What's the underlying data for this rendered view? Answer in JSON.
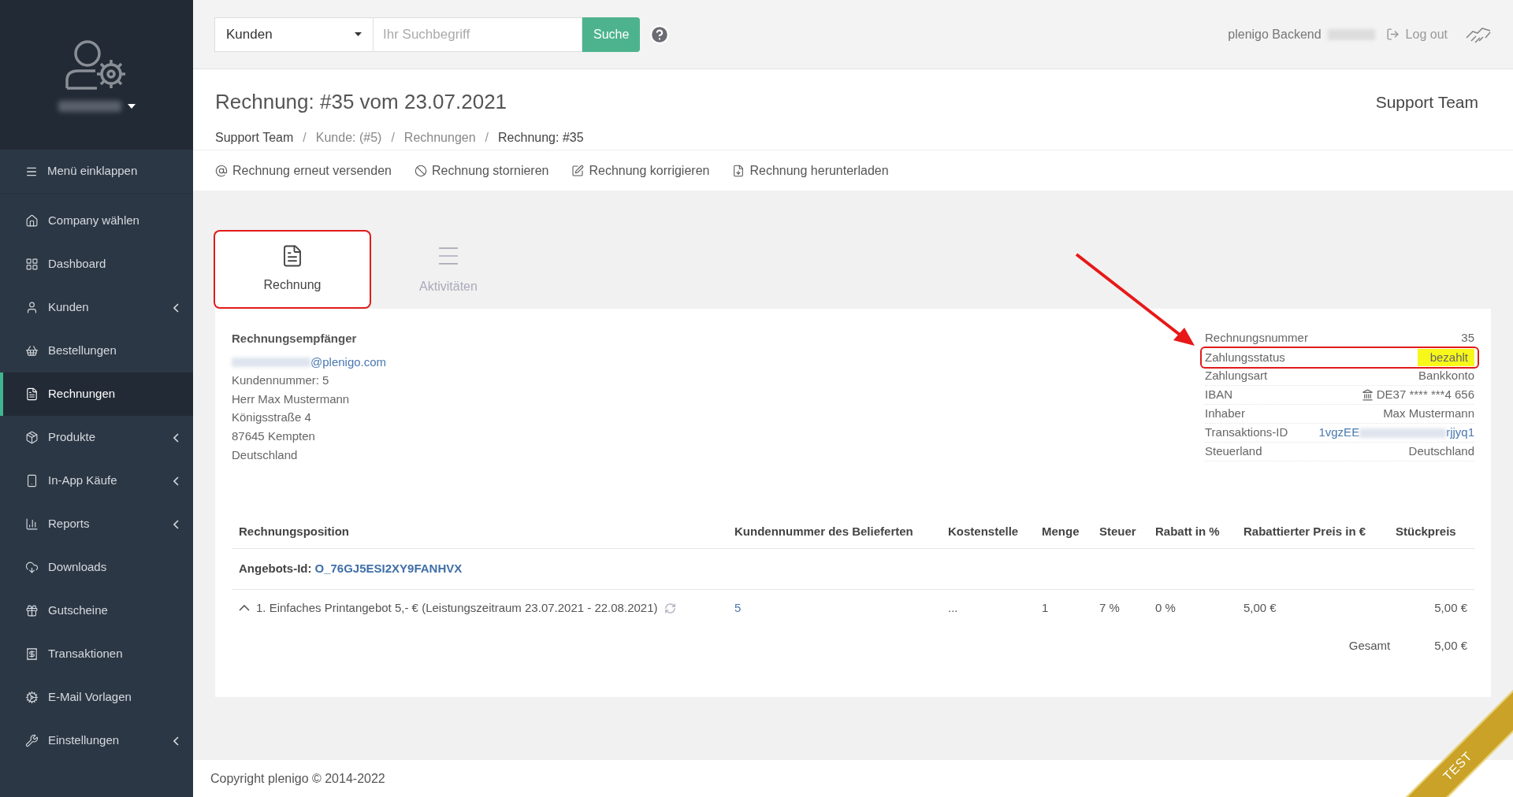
{
  "sidebar": {
    "collapse": "Menü einklappen",
    "items": [
      {
        "label": "Company wählen",
        "selected": false,
        "expandable": false
      },
      {
        "label": "Dashboard",
        "selected": false,
        "expandable": false
      },
      {
        "label": "Kunden",
        "selected": false,
        "expandable": true
      },
      {
        "label": "Bestellungen",
        "selected": false,
        "expandable": false
      },
      {
        "label": "Rechnungen",
        "selected": true,
        "expandable": false
      },
      {
        "label": "Produkte",
        "selected": false,
        "expandable": true
      },
      {
        "label": "In-App Käufe",
        "selected": false,
        "expandable": true
      },
      {
        "label": "Reports",
        "selected": false,
        "expandable": true
      },
      {
        "label": "Downloads",
        "selected": false,
        "expandable": false
      },
      {
        "label": "Gutscheine",
        "selected": false,
        "expandable": false
      },
      {
        "label": "Transaktionen",
        "selected": false,
        "expandable": false
      },
      {
        "label": "E-Mail Vorlagen",
        "selected": false,
        "expandable": false
      },
      {
        "label": "Einstellungen",
        "selected": false,
        "expandable": true
      }
    ]
  },
  "topbar": {
    "search_scope": "Kunden",
    "search": {
      "placeholder": "Ihr Suchbegriff"
    },
    "search_button": "Suche",
    "app_name": "plenigo Backend",
    "logout": "Log out"
  },
  "header": {
    "title": "Rechnung: #35 vom 23.07.2021",
    "breadcrumbs": [
      "Support Team",
      "Kunde: (#5)",
      "Rechnungen",
      "Rechnung: #35"
    ],
    "breadcrumb_separators": [
      "/",
      "/",
      "/"
    ],
    "team": "Support Team"
  },
  "actions": [
    "Rechnung erneut versenden",
    "Rechnung stornieren",
    "Rechnung korrigieren",
    "Rechnung herunterladen"
  ],
  "tabs": [
    {
      "label": "Rechnung",
      "selected": true
    },
    {
      "label": "Aktivitäten",
      "selected": false
    }
  ],
  "recipient": {
    "heading": "Rechnungsempfänger",
    "email": "@plenigo.com",
    "lines": [
      "Kundennummer: 5",
      "Herr Max Mustermann",
      "Königsstraße 4",
      "87645 Kempten",
      "Deutschland"
    ]
  },
  "details": [
    {
      "kind": "text",
      "label": "Rechnungsnummer",
      "value": "35",
      "highlighted": false
    },
    {
      "kind": "text",
      "label": "Zahlungsstatus",
      "value": "bezahlt",
      "highlighted": true
    },
    {
      "kind": "text",
      "label": "Zahlungsart",
      "value": "Bankkonto",
      "highlighted": false
    },
    {
      "kind": "bank",
      "label": "IBAN",
      "value": "DE37 **** ***4 656",
      "highlighted": false
    },
    {
      "kind": "text",
      "label": "Inhaber",
      "value": "Max Mustermann",
      "highlighted": false
    },
    {
      "kind": "redacted",
      "label": "Transaktions-ID",
      "value": "1vgzEE",
      "value_end": "rjjyq1",
      "highlighted": false
    },
    {
      "kind": "text",
      "label": "Steuerland",
      "value": "Deutschland",
      "highlighted": false
    }
  ],
  "table": {
    "columns": [
      "Rechnungsposition",
      "Kundennummer des Belieferten",
      "Kostenstelle",
      "Menge",
      "Steuer",
      "Rabatt in %",
      "Rabattierter Preis in €",
      "Stückpreis"
    ],
    "offer": {
      "label": "Angebots-Id:",
      "id": "O_76GJ5ESI2XY9FANHVX"
    },
    "rows": [
      {
        "expanded": true,
        "cells": [
          "1. Einfaches Printangebot 5,- € (Leistungszeitraum 23.07.2021 - 22.08.2021)",
          "5",
          "...",
          "1",
          "7 %",
          "0 %",
          "5,00 €",
          "5,00 €"
        ]
      }
    ],
    "total": {
      "label": "Gesamt",
      "value": "5,00 €"
    }
  },
  "footer": "Copyright plenigo © 2014-2022",
  "ribbon": "TEST"
}
